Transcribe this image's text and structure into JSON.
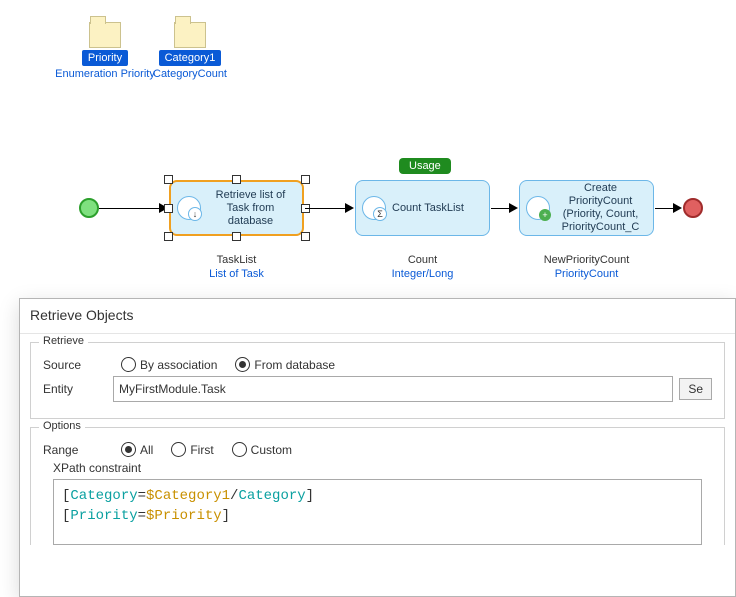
{
  "params": [
    {
      "name": "Priority",
      "type": "Enumeration Priority"
    },
    {
      "name": "Category1",
      "type": "CategoryCount"
    }
  ],
  "usage_badge": "Usage",
  "activities": {
    "retrieve": {
      "label": "Retrieve list of Task from database",
      "return_name": "TaskList",
      "return_type": "List of Task"
    },
    "count": {
      "label": "Count TaskList",
      "return_name": "Count",
      "return_type": "Integer/Long"
    },
    "create": {
      "label": "Create PriorityCount (Priority, Count, PriorityCount_C",
      "return_name": "NewPriorityCount",
      "return_type": "PriorityCount"
    }
  },
  "dialog": {
    "title": "Retrieve Objects",
    "retrieve_legend": "Retrieve",
    "options_legend": "Options",
    "source_label": "Source",
    "entity_label": "Entity",
    "range_label": "Range",
    "by_assoc": "By association",
    "from_db": "From database",
    "entity_value": "MyFirstModule.Task",
    "select_btn": "Se",
    "range_all": "All",
    "range_first": "First",
    "range_custom": "Custom",
    "xpath_label": "XPath constraint",
    "xpath": {
      "line1_attr": "Category",
      "line1_var": "$Category1",
      "line1_path": "Category",
      "line2_attr": "Priority",
      "line2_var": "$Priority"
    }
  }
}
